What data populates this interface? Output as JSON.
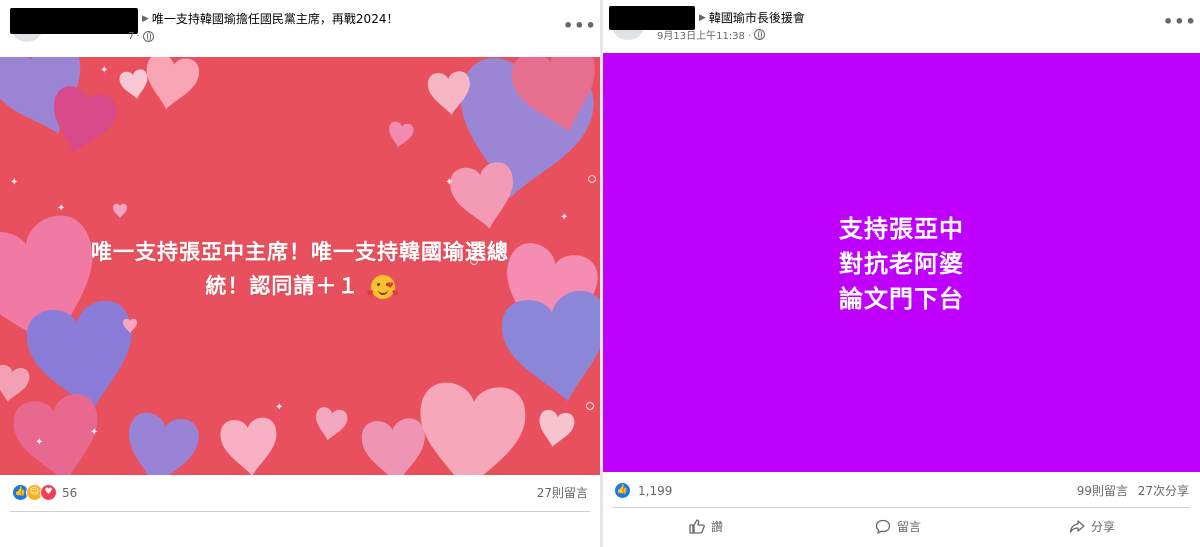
{
  "left_post": {
    "group_title": "唯一支持韓國瑜擔任國民黨主席，再戰2024！",
    "meta_fragment": "7",
    "image_text_line1": "唯一支持張亞中主席！唯一支持韓國瑜選總",
    "image_text_line2": "統！認同請＋１",
    "image_bg": "#e8505e",
    "reaction_icons": [
      "like-icon",
      "haha-icon",
      "love-icon"
    ],
    "reaction_count": "56",
    "comment_count": "27則留言"
  },
  "right_post": {
    "group_title": "韓國瑜市長後援會",
    "timestamp": "9月13日上午11:38 ·",
    "image_text_lines": [
      "支持張亞中",
      "對抗老阿婆",
      "論文門下台"
    ],
    "image_bg": "#c000ff",
    "reaction_icons": [
      "like-icon"
    ],
    "reaction_count": "1,199",
    "comment_count": "99則留言",
    "share_count": "27次分享",
    "actions": {
      "like": "讚",
      "comment": "留言",
      "share": "分享"
    }
  },
  "colors": {
    "accent_blue": "#1877f2",
    "meta_gray": "#65676b"
  }
}
